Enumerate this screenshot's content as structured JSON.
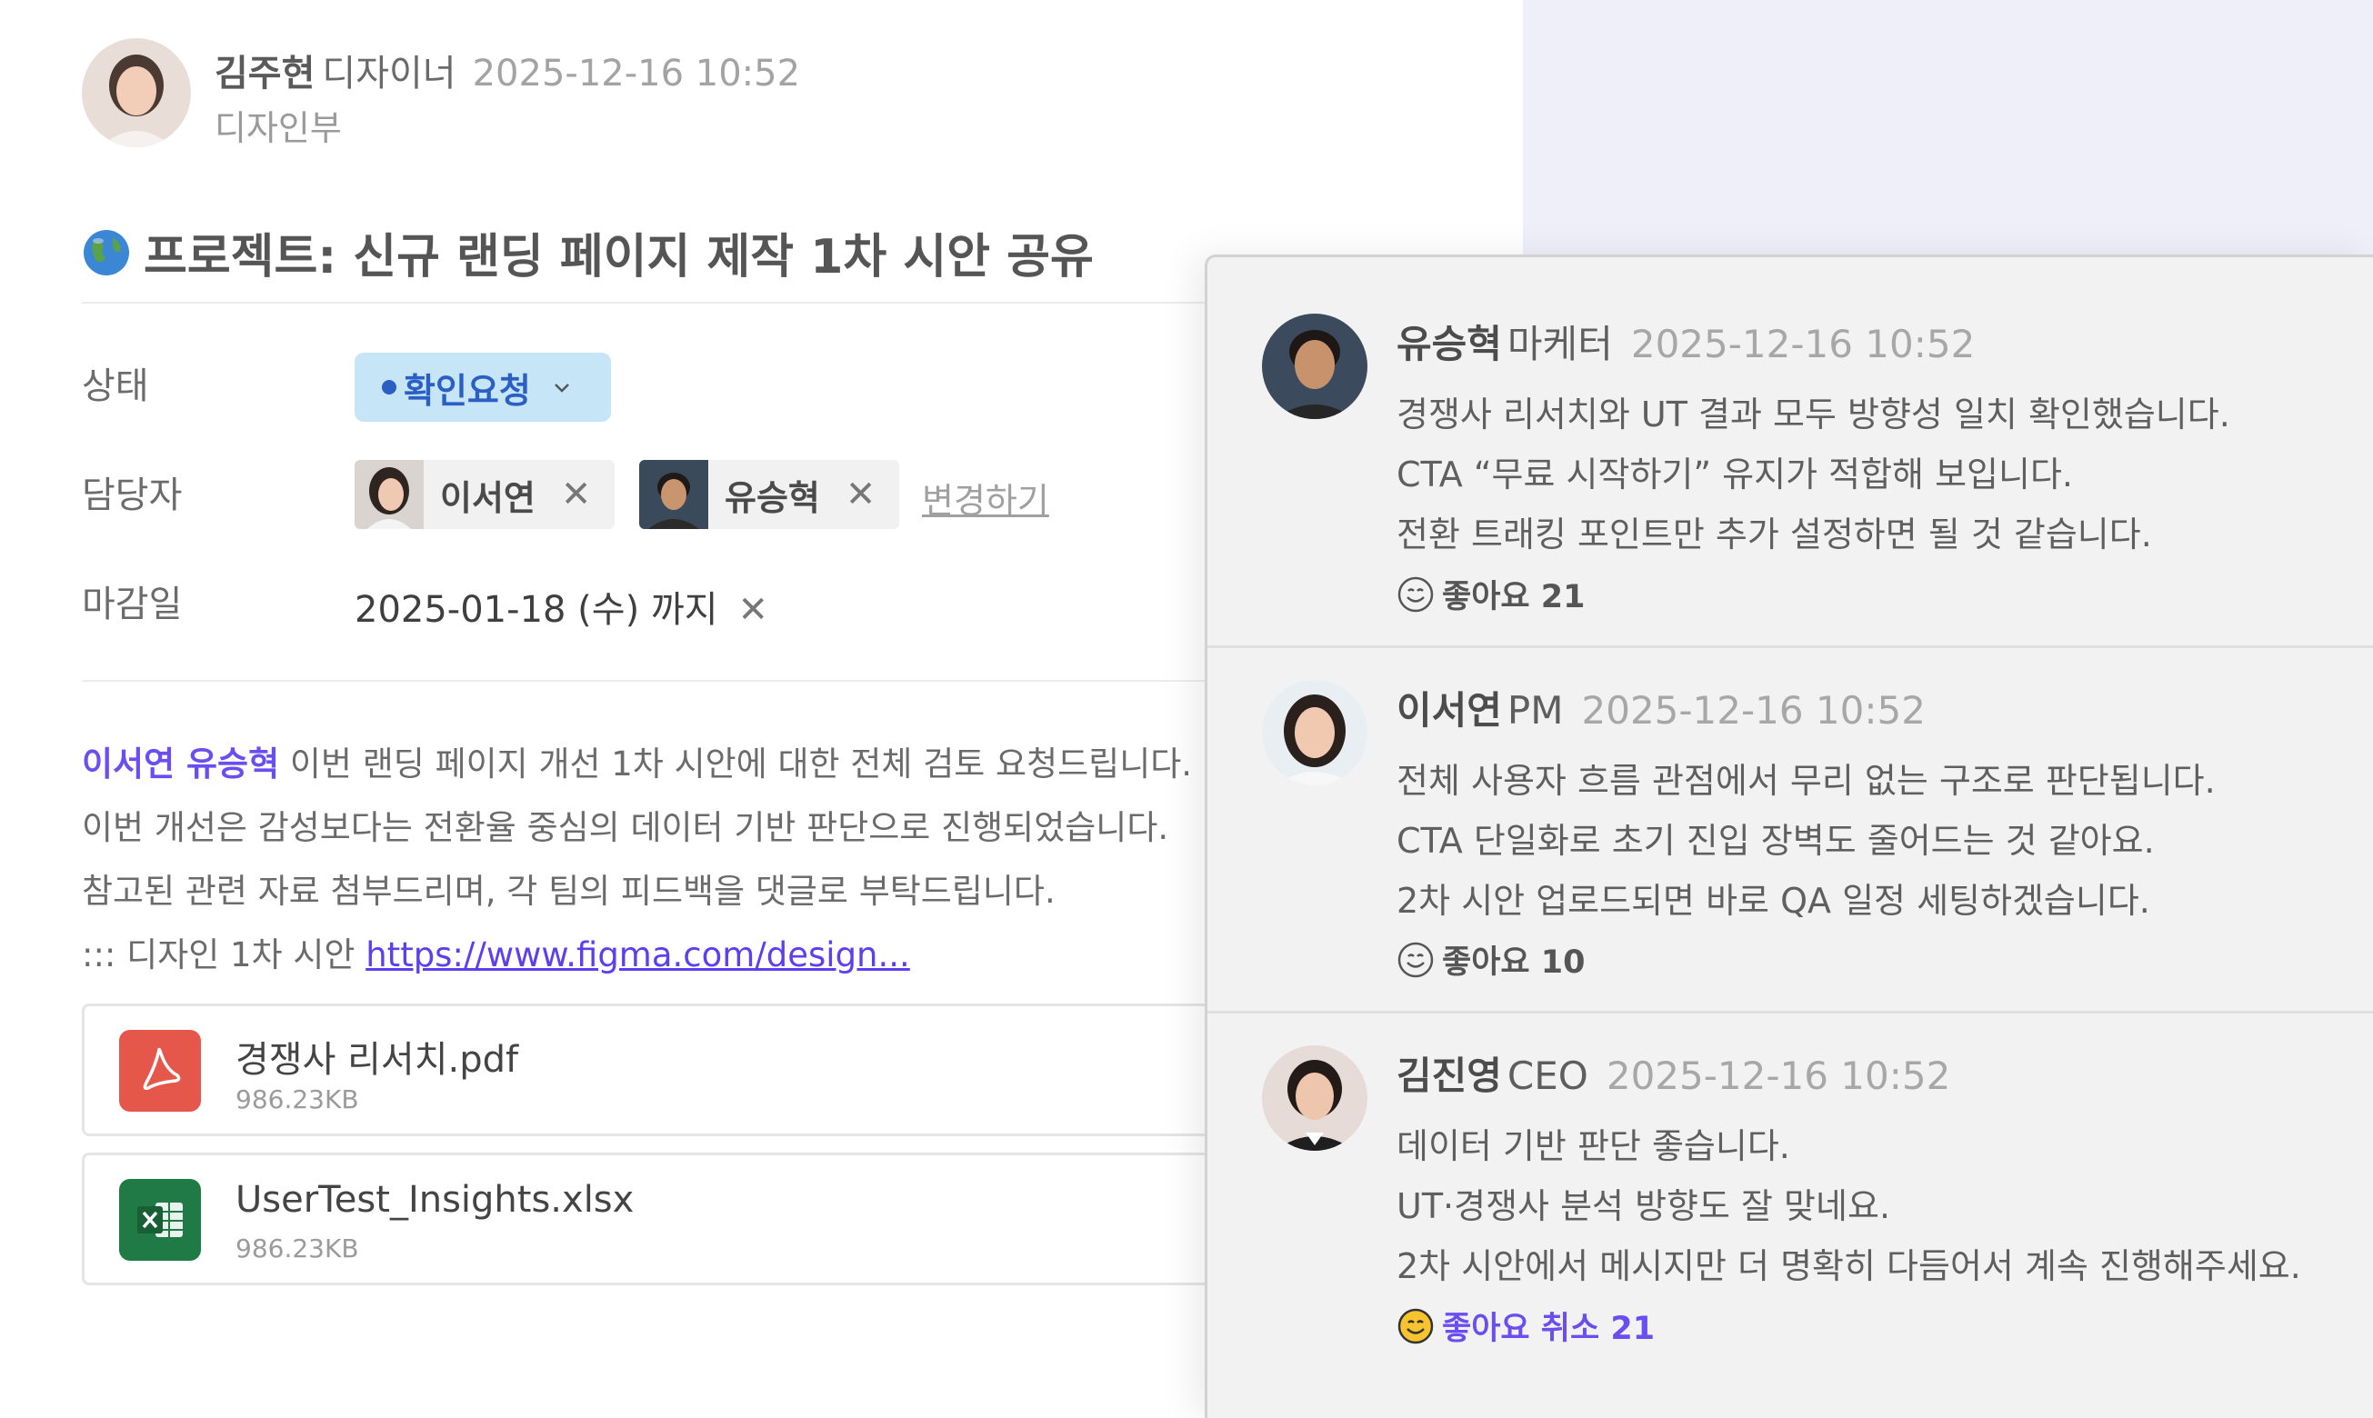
{
  "post": {
    "author": {
      "name": "김주현",
      "role": "디자이너",
      "time": "2025-12-16 10:52",
      "dept": "디자인부"
    },
    "title": "프로젝트: 신규 랜딩 페이지 제작 1차 시안 공유",
    "fields": {
      "status_label": "상태",
      "status_value": "확인요청",
      "assignee_label": "담당자",
      "assignees": [
        "이서연",
        "유승혁"
      ],
      "change_link": "변경하기",
      "deadline_label": "마감일",
      "deadline_value": "2025-01-18 (수) 까지",
      "remove_mark": "✕"
    },
    "body": {
      "mention": "이서연 유승혁",
      "line1_rest": " 이번 랜딩 페이지 개선 1차 시안에 대한 전체 검토 요청드립니다.",
      "line2": "이번 개선은 감성보다는 전환율 중심의 데이터 기반 판단으로 진행되었습니다.",
      "line3": "참고된 관련 자료 첨부드리며, 각 팀의 피드백을 댓글로 부탁드립니다.",
      "line4_prefix": "::: 디자인 1차 시안 ",
      "link_text": "https://www.figma.com/design..."
    },
    "attachments": [
      {
        "name": "경쟁사 리서치.pdf",
        "size": "986.23KB",
        "icon": "pdf-icon",
        "color": "#e5574b"
      },
      {
        "name": "UserTest_Insights.xlsx",
        "size": "986.23KB",
        "icon": "excel-icon",
        "color": "#1f7a45"
      }
    ]
  },
  "comments": [
    {
      "name": "유승혁",
      "role": "마케터",
      "time": "2025-12-16 10:52",
      "lines": [
        "경쟁사 리서치와 UT 결과 모두 방향성 일치 확인했습니다.",
        "CTA “무료 시작하기” 유지가 적합해 보입니다.",
        "전환 트래킹 포인트만 추가 설정하면 될 것 같습니다."
      ],
      "like_text": "좋아요 21"
    },
    {
      "name": "이서연",
      "role": "PM",
      "time": "2025-12-16 10:52",
      "lines": [
        "전체 사용자 흐름 관점에서 무리 없는 구조로 판단됩니다.",
        "CTA 단일화로 초기 진입 장벽도 줄어드는 것 같아요.",
        "2차 시안 업로드되면 바로 QA 일정 세팅하겠습니다."
      ],
      "like_text": "좋아요 10"
    },
    {
      "name": "김진영",
      "role": "CEO",
      "time": "2025-12-16 10:52",
      "lines": [
        "데이터 기반 판단 좋습니다.",
        "UT·경쟁사 분석 방향도 잘 맞네요.",
        "2차 시안에서 메시지만 더 명확히 다듬어서 계속 진행해주세요."
      ],
      "like_text": "좋아요 취소 21"
    }
  ],
  "colors": {
    "accent": "#6b4ef2",
    "status_bg": "#c6e5f6",
    "status_text": "#2c5fc4"
  }
}
